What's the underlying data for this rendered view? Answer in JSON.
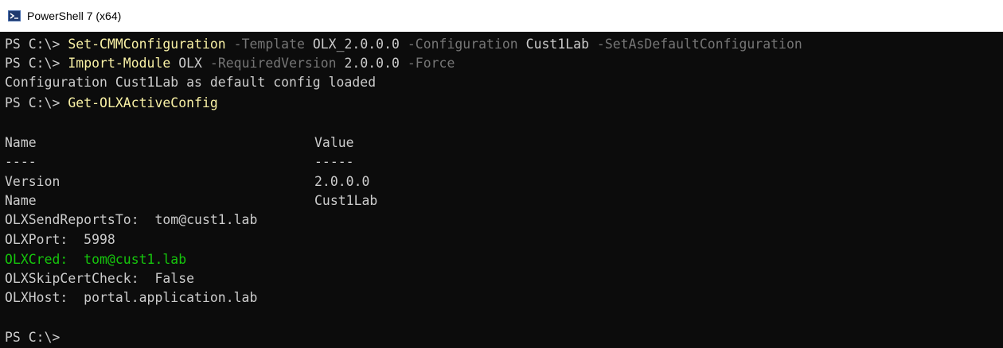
{
  "window": {
    "title": "PowerShell 7 (x64)",
    "icon": "powershell-icon"
  },
  "colors": {
    "background": "#0c0c0c",
    "text": "#cccccc",
    "command": "#f9f1a5",
    "parameter": "#767676",
    "green_output": "#16c60c"
  },
  "terminal": {
    "line1": {
      "prompt": "PS C:\\> ",
      "command": "Set-CMMConfiguration",
      "p1": " -Template",
      "a1": " OLX_2.0.0.0",
      "p2": " -Configuration",
      "a2": " Cust1Lab",
      "p3": " -SetAsDefaultConfiguration"
    },
    "line2": {
      "prompt": "PS C:\\> ",
      "command": "Import-Module",
      "a1": " OLX",
      "p1": " -RequiredVersion",
      "a2": " 2.0.0.0",
      "p2": " -Force"
    },
    "line3": "Configuration Cust1Lab as default config loaded",
    "line4": {
      "prompt": "PS C:\\> ",
      "command": "Get-OLXActiveConfig"
    },
    "table": {
      "headers": [
        "Name",
        "Value"
      ],
      "separators": [
        "----",
        "-----"
      ],
      "rows": [
        {
          "name": "Version",
          "value": "2.0.0.0"
        },
        {
          "name": "Name",
          "value": "Cust1Lab"
        }
      ]
    },
    "output": {
      "send_reports": "OLXSendReportsTo:  tom@cust1.lab",
      "port": "OLXPort:  5998",
      "cred": "OLXCred:  tom@cust1.lab",
      "skip_cert": "OLXSkipCertCheck:  False",
      "host": "OLXHost:  portal.application.lab"
    },
    "final_prompt": "PS C:\\> "
  }
}
